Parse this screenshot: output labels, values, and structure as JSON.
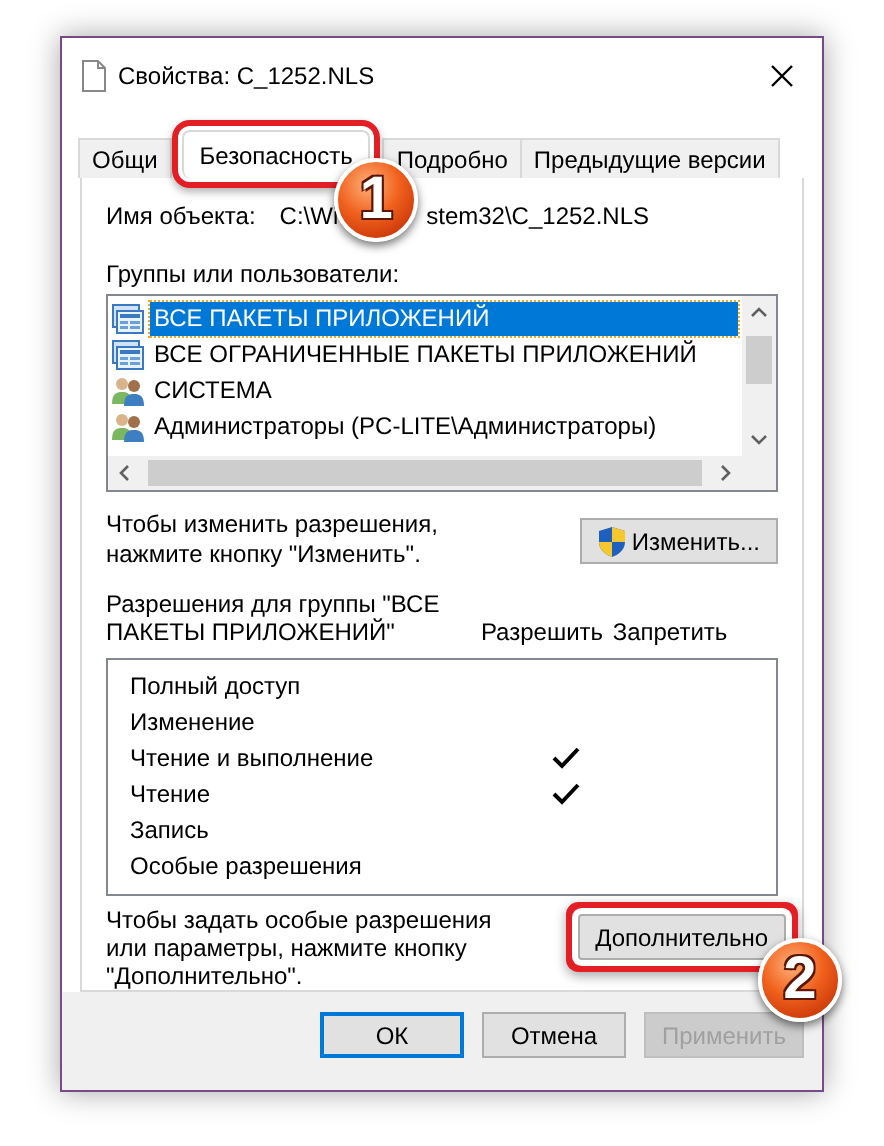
{
  "window": {
    "title": "Свойства: C_1252.NLS"
  },
  "tabs": [
    {
      "label": "Общи",
      "selected": false,
      "highlighted": false
    },
    {
      "label": "Безопасность",
      "selected": true,
      "highlighted": true
    },
    {
      "label": "Подробно",
      "selected": false,
      "highlighted": false
    },
    {
      "label": "Предыдущие версии",
      "selected": false,
      "highlighted": false
    }
  ],
  "object_name": {
    "label": "Имя объекта:",
    "value_parts": [
      "C:\\Wi",
      "stem32\\C_1252.NLS"
    ]
  },
  "groups": {
    "label": "Группы или пользователи:",
    "items": [
      {
        "name": "ВСЕ ПАКЕТЫ ПРИЛОЖЕНИЙ",
        "kind": "package",
        "selected": true
      },
      {
        "name": "ВСЕ ОГРАНИЧЕННЫЕ ПАКЕТЫ ПРИЛОЖЕНИЙ",
        "kind": "package",
        "selected": false
      },
      {
        "name": "СИСТЕМА",
        "kind": "users",
        "selected": false
      },
      {
        "name": "Администраторы (PC-LITE\\Администраторы)",
        "kind": "users",
        "selected": false
      }
    ]
  },
  "change_hint": "Чтобы изменить разрешения, нажмите кнопку \"Изменить\".",
  "change_button": {
    "label": "Изменить..."
  },
  "permissions": {
    "title": "Разрешения для группы \"ВСЕ ПАКЕТЫ ПРИЛОЖЕНИЙ\"",
    "columns": [
      "Разрешить",
      "Запретить"
    ],
    "rows": [
      {
        "name": "Полный доступ",
        "allow": false,
        "deny": false
      },
      {
        "name": "Изменение",
        "allow": false,
        "deny": false
      },
      {
        "name": "Чтение и выполнение",
        "allow": true,
        "deny": false
      },
      {
        "name": "Чтение",
        "allow": true,
        "deny": false
      },
      {
        "name": "Запись",
        "allow": false,
        "deny": false
      },
      {
        "name": "Особые разрешения",
        "allow": false,
        "deny": false
      }
    ]
  },
  "advanced_hint": "Чтобы задать особые разрешения или параметры, нажмите кнопку \"Дополнительно\".",
  "advanced_button": {
    "label": "Дополнительно",
    "highlighted": true
  },
  "buttons": [
    {
      "label": "ОК",
      "default": true,
      "disabled": false
    },
    {
      "label": "Отмена",
      "default": false,
      "disabled": false
    },
    {
      "label": "Применить",
      "default": false,
      "disabled": true
    }
  ],
  "callouts": [
    {
      "number": "1"
    },
    {
      "number": "2"
    }
  ]
}
